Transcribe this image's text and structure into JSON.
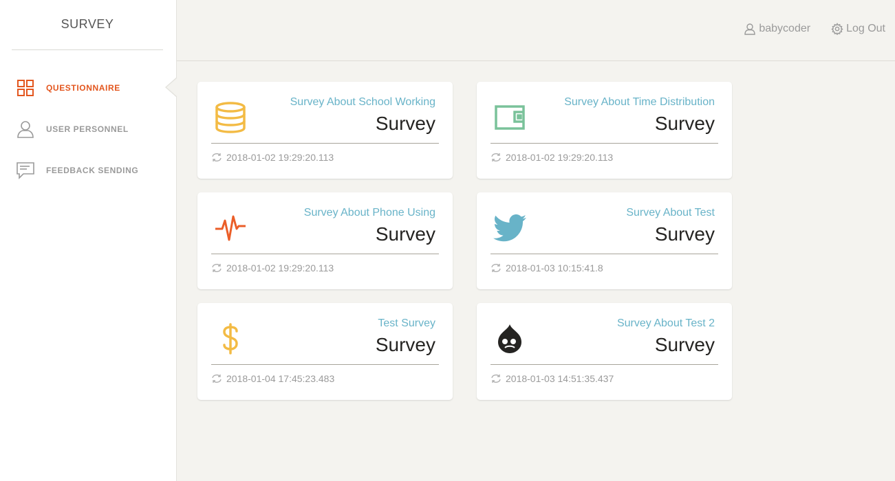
{
  "sidebar": {
    "brand": "SURVEY",
    "items": [
      {
        "label": "QUESTIONNAIRE",
        "icon": "grid-icon",
        "active": true
      },
      {
        "label": "USER PERSONNEL",
        "icon": "user-icon",
        "active": false
      },
      {
        "label": "FEEDBACK SENDING",
        "icon": "chat-icon",
        "active": false
      }
    ]
  },
  "header": {
    "user_label": "babycoder",
    "logout_label": "Log Out"
  },
  "cards": [
    {
      "title": "Survey About School Working",
      "value": "Survey",
      "updated": "2018-01-02 19:29:20.113",
      "icon": "database-icon",
      "color": "#f3bb45"
    },
    {
      "title": "Survey About Time Distribution",
      "value": "Survey",
      "updated": "2018-01-02 19:29:20.113",
      "icon": "wallet-icon",
      "color": "#7ac29a"
    },
    {
      "title": "Survey About Phone Using",
      "value": "Survey",
      "updated": "2018-01-02 19:29:20.113",
      "icon": "pulse-icon",
      "color": "#eb5e28"
    },
    {
      "title": "Survey About Test",
      "value": "Survey",
      "updated": "2018-01-03 10:15:41.8",
      "icon": "twitter-icon",
      "color": "#68b3c8"
    },
    {
      "title": "Test Survey",
      "value": "Survey",
      "updated": "2018-01-04 17:45:23.483",
      "icon": "dollar-icon",
      "color": "#f3bb45"
    },
    {
      "title": "Survey About Test 2",
      "value": "Survey",
      "updated": "2018-01-03 14:51:35.437",
      "icon": "drupal-icon",
      "color": "#252422"
    }
  ],
  "colors": {
    "accent": "#e3561e",
    "title_blue": "#68b3c8",
    "background": "#f4f3ef"
  }
}
